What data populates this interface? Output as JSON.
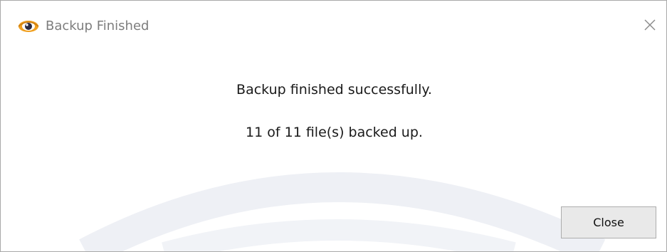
{
  "window": {
    "title": "Backup Finished",
    "app_icon": "eye-app-icon",
    "close_icon": "close-icon"
  },
  "message": {
    "line1": "Backup finished successfully.",
    "line2": "11 of 11 file(s) backed up."
  },
  "buttons": {
    "close_label": "Close"
  },
  "colors": {
    "title_text": "#7d7d7d",
    "message_text": "#1a1a1a",
    "button_bg": "#e9e9e9",
    "button_border": "#adadad",
    "icon_orange": "#f0a020",
    "icon_dark": "#2a2a40",
    "watermark": "#eef0f4"
  }
}
